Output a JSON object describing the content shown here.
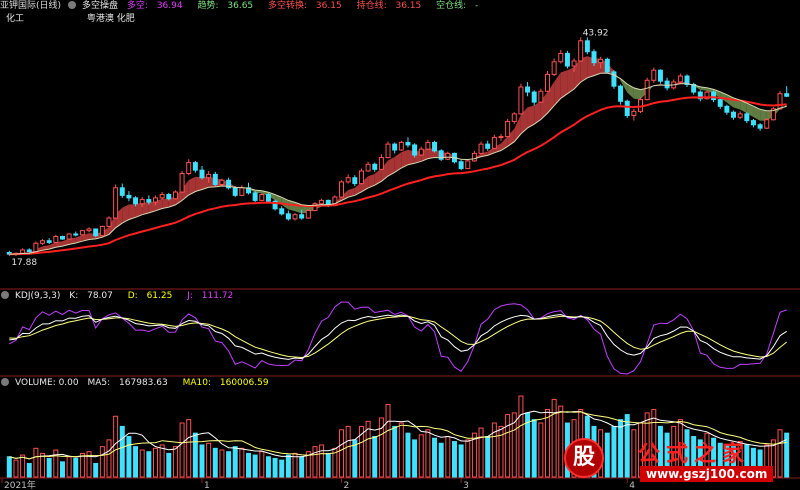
{
  "header": {
    "stock_name": "亚钾国际(日线)",
    "indicator_name": "多空操盘",
    "duokong_label": "多空: ",
    "duokong_value": "36.94",
    "trend_label": "趋势: ",
    "trend_value": "36.65",
    "turn_label": "多空转换: ",
    "turn_value": "36.15",
    "hold_label": "持仓线: ",
    "hold_value": "36.15",
    "empty_label": "空仓线: ",
    "empty_value": "-"
  },
  "sub_labels": {
    "left": "化工",
    "right": "粤港澳 化肥"
  },
  "colors": {
    "up": "#ff5050",
    "down": "#40e0ff",
    "ribbon_bull": "#b83a3a",
    "ribbon_bear": "#6b8a4a",
    "hold_line": "#ff2020",
    "trend_line": "#d8d8b0",
    "k_line": "#ffffff",
    "d_line": "#ffff80",
    "j_line": "#c040ff",
    "ma5": "#ffffff",
    "ma10": "#ffff80"
  },
  "kdj_header": {
    "name": "KDJ(9,3,3)",
    "k_label": "K: ",
    "k_value": "78.07",
    "d_label": "D: ",
    "d_value": "61.25",
    "j_label": "J: ",
    "j_value": "111.72"
  },
  "vol_header": {
    "name": "VOLUME: 0.00",
    "ma5_label": "MA5: ",
    "ma5_value": "167983.63",
    "ma10_label": "MA10: ",
    "ma10_value": "160006.59"
  },
  "watermark": {
    "logo": "股",
    "title": "公式之家",
    "url": "www.gszj100.com"
  },
  "chart_data": [
    {
      "type": "candlestick",
      "title": "亚钾国际(日线)",
      "series": [
        {
          "name": "多空",
          "last": 36.94
        },
        {
          "name": "趋势",
          "last": 36.65
        },
        {
          "name": "持仓线",
          "last": 36.15
        }
      ],
      "price_range": [
        15.5,
        45.5
      ],
      "annotations": {
        "high": "43.92",
        "low": "17.88"
      },
      "ohlc": [
        [
          18.3,
          18.5,
          17.9,
          18.1
        ],
        [
          18.1,
          18.3,
          17.9,
          18.2
        ],
        [
          18.2,
          18.8,
          18.1,
          18.6
        ],
        [
          18.6,
          18.8,
          18.3,
          18.4
        ],
        [
          18.4,
          19.6,
          18.3,
          19.4
        ],
        [
          19.4,
          19.9,
          19.2,
          19.7
        ],
        [
          19.7,
          20.0,
          19.3,
          19.5
        ],
        [
          19.5,
          20.4,
          19.4,
          20.2
        ],
        [
          20.2,
          20.3,
          19.8,
          19.9
        ],
        [
          19.9,
          20.6,
          19.8,
          20.5
        ],
        [
          20.5,
          20.8,
          20.2,
          20.4
        ],
        [
          20.4,
          21.0,
          20.3,
          20.9
        ],
        [
          20.9,
          21.3,
          20.7,
          21.1
        ],
        [
          21.1,
          21.1,
          20.1,
          20.3
        ],
        [
          20.3,
          21.5,
          20.2,
          21.4
        ],
        [
          21.4,
          22.6,
          21.3,
          22.4
        ],
        [
          22.4,
          26.4,
          22.3,
          26.0
        ],
        [
          26.0,
          26.5,
          24.8,
          25.1
        ],
        [
          25.1,
          25.6,
          24.4,
          24.8
        ],
        [
          24.8,
          25.0,
          23.8,
          24.1
        ],
        [
          24.1,
          24.9,
          23.7,
          24.6
        ],
        [
          24.6,
          25.1,
          24.0,
          24.3
        ],
        [
          24.3,
          25.1,
          23.9,
          24.8
        ],
        [
          24.8,
          25.5,
          24.6,
          25.2
        ],
        [
          25.2,
          25.4,
          24.5,
          24.7
        ],
        [
          24.7,
          25.7,
          24.6,
          25.5
        ],
        [
          25.5,
          28.0,
          25.4,
          27.7
        ],
        [
          27.7,
          29.4,
          27.5,
          29.0
        ],
        [
          29.0,
          29.2,
          27.8,
          28.1
        ],
        [
          28.1,
          28.6,
          27.0,
          27.2
        ],
        [
          27.2,
          28.0,
          26.6,
          27.6
        ],
        [
          27.6,
          27.9,
          26.2,
          26.4
        ],
        [
          26.4,
          27.1,
          26.2,
          26.9
        ],
        [
          26.9,
          27.2,
          25.8,
          26.0
        ],
        [
          26.0,
          26.2,
          24.9,
          25.1
        ],
        [
          25.1,
          26.3,
          25.0,
          26.0
        ],
        [
          26.0,
          26.6,
          25.2,
          25.4
        ],
        [
          25.4,
          25.6,
          24.3,
          24.5
        ],
        [
          24.5,
          25.4,
          24.4,
          25.2
        ],
        [
          25.2,
          25.4,
          24.2,
          24.4
        ],
        [
          24.4,
          24.6,
          23.3,
          23.5
        ],
        [
          23.5,
          23.8,
          22.7,
          22.9
        ],
        [
          22.9,
          23.3,
          22.1,
          22.3
        ],
        [
          22.3,
          23.0,
          22.1,
          22.8
        ],
        [
          22.8,
          23.4,
          22.2,
          22.4
        ],
        [
          22.4,
          23.5,
          22.3,
          23.3
        ],
        [
          23.3,
          24.3,
          23.2,
          24.1
        ],
        [
          24.1,
          24.7,
          24.0,
          24.5
        ],
        [
          24.5,
          24.6,
          23.7,
          23.9
        ],
        [
          23.9,
          25.1,
          23.8,
          24.9
        ],
        [
          24.9,
          26.9,
          24.8,
          26.7
        ],
        [
          26.7,
          27.6,
          26.5,
          27.2
        ],
        [
          27.2,
          27.5,
          26.2,
          26.5
        ],
        [
          26.5,
          28.3,
          26.4,
          28.0
        ],
        [
          28.0,
          29.1,
          27.9,
          28.8
        ],
        [
          28.8,
          29.0,
          27.9,
          28.2
        ],
        [
          28.2,
          30.0,
          28.1,
          29.6
        ],
        [
          29.6,
          31.5,
          29.5,
          31.2
        ],
        [
          31.2,
          31.4,
          30.1,
          30.5
        ],
        [
          30.5,
          31.6,
          30.4,
          31.4
        ],
        [
          31.4,
          32.0,
          30.8,
          31.1
        ],
        [
          31.1,
          31.3,
          29.6,
          29.9
        ],
        [
          29.9,
          30.9,
          29.8,
          30.6
        ],
        [
          30.6,
          31.7,
          30.5,
          31.4
        ],
        [
          31.4,
          31.6,
          30.2,
          30.4
        ],
        [
          30.4,
          30.6,
          29.2,
          29.4
        ],
        [
          29.4,
          30.3,
          29.3,
          30.1
        ],
        [
          30.1,
          30.2,
          28.9,
          29.1
        ],
        [
          29.1,
          29.3,
          28.1,
          28.3
        ],
        [
          28.3,
          29.4,
          28.2,
          29.2
        ],
        [
          29.2,
          30.4,
          29.1,
          30.1
        ],
        [
          30.1,
          31.5,
          30.0,
          31.2
        ],
        [
          31.2,
          31.6,
          30.4,
          30.7
        ],
        [
          30.7,
          32.3,
          30.6,
          32.0
        ],
        [
          32.0,
          32.4,
          31.6,
          32.1
        ],
        [
          32.1,
          34.2,
          32.0,
          33.9
        ],
        [
          33.9,
          35.0,
          33.6,
          34.8
        ],
        [
          34.8,
          38.4,
          34.7,
          38.0
        ],
        [
          38.0,
          38.6,
          36.9,
          37.4
        ],
        [
          37.4,
          37.6,
          35.8,
          36.2
        ],
        [
          36.2,
          37.8,
          36.1,
          37.5
        ],
        [
          37.5,
          39.9,
          37.4,
          39.5
        ],
        [
          39.5,
          41.4,
          39.3,
          41.0
        ],
        [
          41.0,
          42.4,
          40.8,
          42.0
        ],
        [
          42.0,
          42.3,
          40.2,
          40.5
        ],
        [
          40.5,
          41.4,
          39.8,
          41.1
        ],
        [
          41.1,
          43.9,
          41.0,
          43.5
        ],
        [
          43.5,
          43.9,
          41.9,
          42.2
        ],
        [
          42.2,
          42.5,
          40.5,
          40.9
        ],
        [
          40.9,
          41.6,
          40.2,
          41.3
        ],
        [
          41.3,
          41.5,
          39.6,
          39.8
        ],
        [
          39.8,
          40.0,
          37.8,
          38.1
        ],
        [
          38.1,
          38.3,
          35.9,
          36.3
        ],
        [
          36.3,
          36.5,
          34.3,
          34.6
        ],
        [
          34.6,
          35.4,
          34.0,
          35.1
        ],
        [
          35.1,
          36.8,
          34.9,
          36.5
        ],
        [
          36.5,
          39.1,
          36.4,
          38.8
        ],
        [
          38.8,
          40.3,
          38.5,
          40.0
        ],
        [
          40.0,
          40.1,
          38.4,
          38.7
        ],
        [
          38.7,
          39.1,
          37.6,
          37.9
        ],
        [
          37.9,
          38.9,
          37.7,
          38.6
        ],
        [
          38.6,
          39.6,
          38.4,
          39.3
        ],
        [
          39.3,
          39.5,
          38.0,
          38.3
        ],
        [
          38.3,
          38.5,
          37.1,
          37.4
        ],
        [
          37.4,
          37.6,
          36.3,
          36.6
        ],
        [
          36.6,
          37.6,
          36.5,
          37.4
        ],
        [
          37.4,
          37.6,
          36.2,
          36.5
        ],
        [
          36.5,
          36.7,
          35.4,
          35.7
        ],
        [
          35.7,
          35.9,
          34.7,
          35.0
        ],
        [
          35.0,
          35.2,
          34.1,
          34.4
        ],
        [
          34.4,
          35.1,
          34.2,
          34.8
        ],
        [
          34.8,
          35.0,
          33.7,
          34.0
        ],
        [
          34.0,
          34.2,
          33.2,
          33.5
        ],
        [
          33.5,
          33.7,
          32.8,
          33.1
        ],
        [
          33.1,
          34.3,
          33.0,
          34.1
        ],
        [
          34.1,
          35.6,
          34.0,
          35.4
        ],
        [
          35.4,
          37.5,
          35.3,
          37.2
        ],
        [
          37.2,
          38.1,
          36.8,
          36.9
        ]
      ],
      "volume": [
        60,
        50,
        65,
        40,
        85,
        70,
        55,
        80,
        45,
        60,
        55,
        70,
        75,
        40,
        90,
        110,
        180,
        150,
        120,
        90,
        80,
        75,
        85,
        95,
        70,
        90,
        160,
        170,
        130,
        95,
        100,
        85,
        80,
        75,
        90,
        85,
        70,
        65,
        75,
        60,
        55,
        50,
        65,
        70,
        60,
        75,
        90,
        95,
        70,
        85,
        140,
        150,
        110,
        150,
        165,
        120,
        175,
        215,
        150,
        160,
        130,
        110,
        125,
        140,
        115,
        100,
        120,
        105,
        95,
        110,
        130,
        145,
        120,
        160,
        150,
        185,
        190,
        240,
        190,
        170,
        160,
        200,
        230,
        210,
        160,
        170,
        200,
        180,
        150,
        140,
        130,
        150,
        170,
        185,
        140,
        160,
        190,
        200,
        150,
        130,
        150,
        170,
        140,
        120,
        110,
        130,
        115,
        100,
        95,
        90,
        105,
        95,
        85,
        80,
        95,
        110,
        140,
        130
      ]
    },
    {
      "type": "line",
      "title": "KDJ(9,3,3)",
      "series": [
        {
          "name": "K",
          "last": 78.07
        },
        {
          "name": "D",
          "last": 61.25
        },
        {
          "name": "J",
          "last": 111.72
        }
      ]
    },
    {
      "type": "bar",
      "title": "VOLUME",
      "series": [
        {
          "name": "MA5",
          "last": 167983.63
        },
        {
          "name": "MA10",
          "last": 160006.59
        }
      ],
      "x_ticks": [
        "2021年",
        "1",
        "2",
        "3",
        "4"
      ]
    }
  ]
}
